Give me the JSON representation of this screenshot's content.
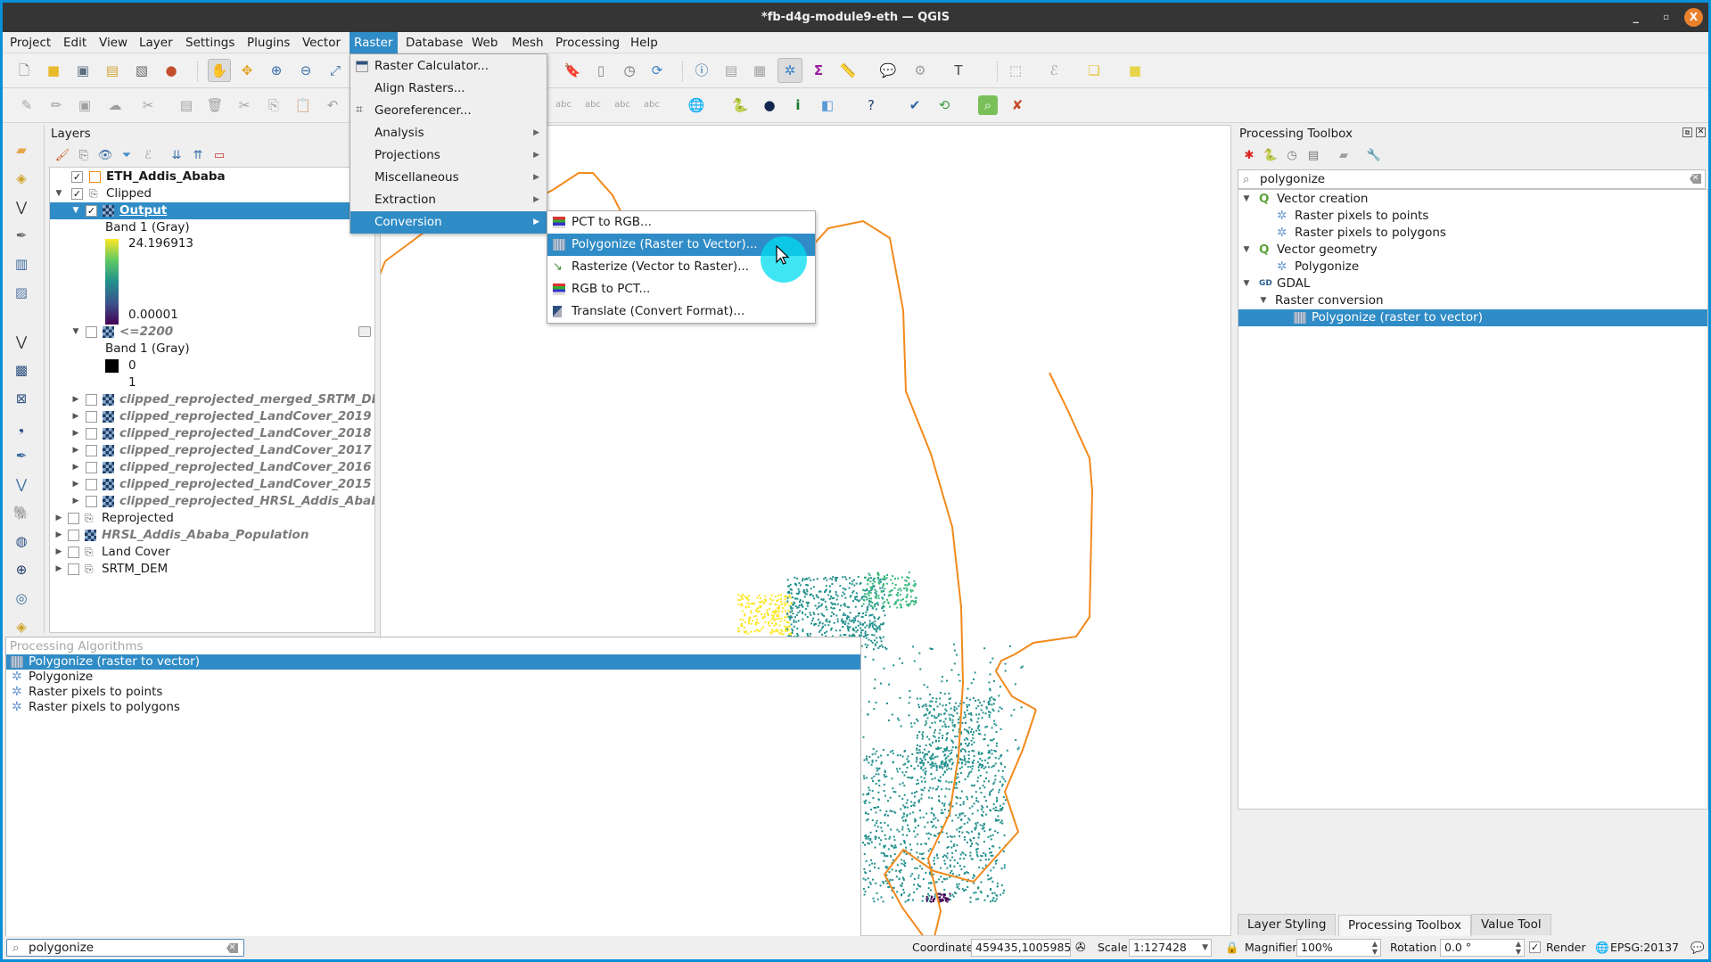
{
  "window": {
    "title": "*fb-d4g-module9-eth — QGIS",
    "close_glyph": "X",
    "min_glyph": "_",
    "max_glyph": "▫"
  },
  "menubar": [
    "Project",
    "Edit",
    "View",
    "Layer",
    "Settings",
    "Plugins",
    "Vector",
    "Raster",
    "Database",
    "Web",
    "Mesh",
    "Processing",
    "Help"
  ],
  "raster_menu": {
    "items": [
      {
        "label": "Raster Calculator...",
        "icon": "raster-calculator-icon",
        "submenu": false
      },
      {
        "label": "Align Rasters...",
        "icon": "",
        "submenu": false
      },
      {
        "label": "Georeferencer...",
        "icon": "georeferencer-icon",
        "submenu": false
      },
      {
        "label": "Analysis",
        "icon": "",
        "submenu": true
      },
      {
        "label": "Projections",
        "icon": "",
        "submenu": true
      },
      {
        "label": "Miscellaneous",
        "icon": "",
        "submenu": true
      },
      {
        "label": "Extraction",
        "icon": "",
        "submenu": true
      },
      {
        "label": "Conversion",
        "icon": "",
        "submenu": true
      }
    ],
    "highlighted": "Conversion"
  },
  "conversion_menu": {
    "items": [
      {
        "label": "PCT to RGB...",
        "icon": "pct-to-rgb-icon"
      },
      {
        "label": "Polygonize (Raster to Vector)...",
        "icon": "polygonize-icon"
      },
      {
        "label": "Rasterize (Vector to Raster)...",
        "icon": "rasterize-icon"
      },
      {
        "label": "RGB to PCT...",
        "icon": "rgb-to-pct-icon"
      },
      {
        "label": "Translate (Convert Format)...",
        "icon": "translate-icon"
      }
    ],
    "highlighted": "Polygonize (Raster to Vector)..."
  },
  "layers_panel": {
    "title": "Layers",
    "rows": [
      {
        "label": "ETH_Addis_Ababa",
        "kind": "vector",
        "checked": true,
        "indent": 1,
        "style": "bold"
      },
      {
        "label": "Clipped",
        "kind": "group",
        "checked": true,
        "indent": 1,
        "expanded": true
      },
      {
        "label": "Output",
        "kind": "raster",
        "checked": true,
        "indent": 2,
        "expanded": true,
        "selected": true
      },
      {
        "label": "Band 1 (Gray)",
        "kind": "legend-label",
        "indent": 3
      },
      {
        "label": "24.196913",
        "kind": "legend-max",
        "indent": 3
      },
      {
        "label": "0.00001",
        "kind": "legend-min",
        "indent": 3
      },
      {
        "label": "<=2200",
        "kind": "raster",
        "checked": false,
        "indent": 2,
        "expanded": true,
        "style": "italic"
      },
      {
        "label": "Band 1 (Gray)",
        "kind": "legend-label",
        "indent": 3
      },
      {
        "label": "0",
        "kind": "legend-swatch-black",
        "indent": 3
      },
      {
        "label": "1",
        "kind": "legend-swatch-white",
        "indent": 3
      },
      {
        "label": "clipped_reprojected_merged_SRTM_DE",
        "kind": "raster",
        "checked": false,
        "indent": 2,
        "style": "italic"
      },
      {
        "label": "clipped_reprojected_LandCover_2019",
        "kind": "raster",
        "checked": false,
        "indent": 2,
        "style": "italic"
      },
      {
        "label": "clipped_reprojected_LandCover_2018",
        "kind": "raster",
        "checked": false,
        "indent": 2,
        "style": "italic"
      },
      {
        "label": "clipped_reprojected_LandCover_2017",
        "kind": "raster",
        "checked": false,
        "indent": 2,
        "style": "italic"
      },
      {
        "label": "clipped_reprojected_LandCover_2016",
        "kind": "raster",
        "checked": false,
        "indent": 2,
        "style": "italic"
      },
      {
        "label": "clipped_reprojected_LandCover_2015",
        "kind": "raster",
        "checked": false,
        "indent": 2,
        "style": "italic"
      },
      {
        "label": "clipped_reprojected_HRSL_Addis_Abab",
        "kind": "raster",
        "checked": false,
        "indent": 2,
        "style": "italic"
      },
      {
        "label": "Reprojected",
        "kind": "group",
        "checked": false,
        "indent": 1
      },
      {
        "label": "HRSL_Addis_Ababa_Population",
        "kind": "raster",
        "checked": false,
        "indent": 1,
        "style": "italic"
      },
      {
        "label": "Land Cover",
        "kind": "group",
        "checked": false,
        "indent": 1
      },
      {
        "label": "SRTM_DEM",
        "kind": "group",
        "checked": false,
        "indent": 1
      }
    ]
  },
  "processing_toolbox": {
    "title": "Processing Toolbox",
    "search_value": "polygonize",
    "tree": [
      {
        "label": "Vector creation",
        "level": 0,
        "icon": "qgis-icon",
        "expander": true
      },
      {
        "label": "Raster pixels to points",
        "level": 1,
        "icon": "gear-icon"
      },
      {
        "label": "Raster pixels to polygons",
        "level": 1,
        "icon": "gear-icon"
      },
      {
        "label": "Vector geometry",
        "level": 0,
        "icon": "qgis-icon",
        "expander": true
      },
      {
        "label": "Polygonize",
        "level": 1,
        "icon": "gear-icon"
      },
      {
        "label": "GDAL",
        "level": 0,
        "icon": "gdal-icon",
        "expander": true
      },
      {
        "label": "Raster conversion",
        "level": 1,
        "icon": "",
        "expander": true
      },
      {
        "label": "Polygonize (raster to vector)",
        "level": 2,
        "icon": "polygonize-icon",
        "selected": true
      }
    ],
    "tabs": [
      {
        "label": "Layer Styling",
        "active": false
      },
      {
        "label": "Processing Toolbox",
        "active": true
      },
      {
        "label": "Value Tool",
        "active": false
      }
    ]
  },
  "locator_results": {
    "group": "Processing Algorithms",
    "items": [
      {
        "label": "Polygonize (raster to vector)",
        "icon": "polygonize-icon",
        "selected": true
      },
      {
        "label": "Polygonize",
        "icon": "gear-icon"
      },
      {
        "label": "Raster pixels to points",
        "icon": "gear-icon"
      },
      {
        "label": "Raster pixels to polygons",
        "icon": "gear-icon"
      }
    ]
  },
  "locator": {
    "value": "polygonize"
  },
  "statusbar": {
    "coordinate_label": "Coordinate",
    "coordinate_value": "459435,1005985",
    "scale_label": "Scale",
    "scale_value": "1:127428",
    "magnifier_label": "Magnifier",
    "magnifier_value": "100%",
    "rotation_label": "Rotation",
    "rotation_value": "0.0 °",
    "render_label": "Render",
    "render_checked": true,
    "crs": "EPSG:20137"
  },
  "colors": {
    "accent": "#308cc6",
    "boundary": "#f28a1c",
    "raster_low": "#440154",
    "raster_mid": "#21908d",
    "raster_high": "#fde725",
    "titlebar": "#353535",
    "close": "#e9812d"
  }
}
